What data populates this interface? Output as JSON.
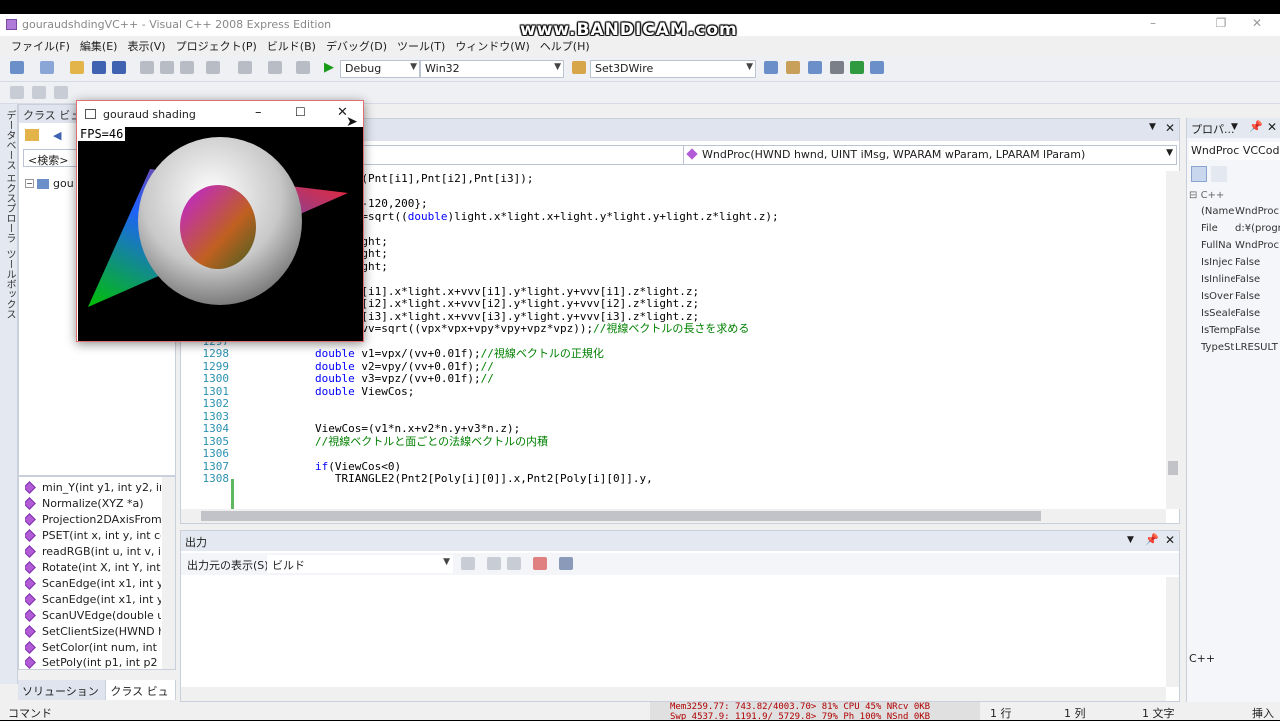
{
  "watermark": "www.BANDICAM.com",
  "window": {
    "title": "gouraudshdingVC++ - Visual C++ 2008 Express Edition"
  },
  "menu": [
    "ファイル(F)",
    "編集(E)",
    "表示(V)",
    "プロジェクト(P)",
    "ビルド(B)",
    "デバッグ(D)",
    "ツール(T)",
    "ウィンドウ(W)",
    "ヘルプ(H)"
  ],
  "toolbar": {
    "config": "Debug",
    "platform": "Win32",
    "find_text": "Set3DWire"
  },
  "side_tabs": [
    "データベース エクスプローラ",
    "ツールボックス"
  ],
  "classview": {
    "title": "クラス ビュー",
    "search_placeholder": "<検索>",
    "root": "gou"
  },
  "members": [
    "min_Y(int y1, int y2, in",
    "Normalize(XYZ *a)",
    "Projection2DAxisFrom",
    "PSET(int x, int y, int cc",
    "readRGB(int u, int v, ir",
    "Rotate(int X, int Y, int",
    "ScanEdge(int x1, int y",
    "ScanEdge(int x1, int y",
    "ScanUVEdge(double u",
    "SetClientSize(HWND h",
    "SetColor(int num, int r",
    "SetPoly(int p1, int p2"
  ],
  "left_bottom_tabs": [
    "ソリューション ...",
    "クラス ビュー"
  ],
  "editor": {
    "function_combo": "WndProc(HWND hwnd, UINT iMsg, WPARAM wParam, LPARAM lParam)",
    "lines": [
      {
        "n": "",
        "segs": [
          {
            "t": "lcCross(Pnt[i1],Pnt[i2],Pnt[i3]);",
            "c": ""
          }
        ]
      },
      {
        "n": "",
        "segs": []
      },
      {
        "n": "",
        "segs": [
          {
            "t": "t={100,-120,200};",
            "c": ""
          }
        ]
      },
      {
        "n": "",
        "segs": [
          {
            "t": "enlight=sqrt((",
            "c": ""
          },
          {
            "t": "double",
            "c": "kw"
          },
          {
            "t": ")light.x*light.x+light.y*light.y+light.z*light.z);",
            "c": ""
          }
        ]
      },
      {
        "n": "",
        "segs": []
      },
      {
        "n": "",
        "segs": [
          {
            "t": "/=lenlight;",
            "c": ""
          }
        ]
      },
      {
        "n": "",
        "segs": [
          {
            "t": "/=lenlight;",
            "c": ""
          }
        ]
      },
      {
        "n": "",
        "segs": [
          {
            "t": "/=lenlight;",
            "c": ""
          }
        ]
      },
      {
        "n": "",
        "segs": []
      },
      {
        "n": "",
        "segs": [
          {
            "t": "pe1=vvv[i1].x*light.x+vvv[i1].y*light.y+vvv[i1].z*light.z;",
            "c": ""
          }
        ]
      },
      {
        "n": "",
        "segs": [
          {
            "t": "pe2=vvv[i2].x*light.x+vvv[i2].y*light.y+vvv[i2].z*light.z;",
            "c": ""
          }
        ]
      },
      {
        "n": "",
        "segs": [
          {
            "t": "pe3=vvv[i3].x*light.x+vvv[i3].y*light.y+vvv[i3].z*light.z;",
            "c": ""
          }
        ]
      },
      {
        "n": "1296",
        "segs": [
          {
            "t": "double",
            "c": "kw"
          },
          {
            "t": " vv=sqrt((vpx*vpx+vpy*vpy+vpz*vpz));",
            "c": ""
          },
          {
            "t": "//視線ベクトルの長さを求める",
            "c": "cm"
          }
        ]
      },
      {
        "n": "1297",
        "segs": []
      },
      {
        "n": "1298",
        "segs": [
          {
            "t": "double",
            "c": "kw"
          },
          {
            "t": " v1=vpx/(vv+0.01f);",
            "c": ""
          },
          {
            "t": "//視線ベクトルの正規化",
            "c": "cm"
          }
        ]
      },
      {
        "n": "1299",
        "segs": [
          {
            "t": "double",
            "c": "kw"
          },
          {
            "t": " v2=vpy/(vv+0.01f);",
            "c": ""
          },
          {
            "t": "//",
            "c": "cm"
          }
        ]
      },
      {
        "n": "1300",
        "segs": [
          {
            "t": "double",
            "c": "kw"
          },
          {
            "t": " v3=vpz/(vv+0.01f);",
            "c": ""
          },
          {
            "t": "//",
            "c": "cm"
          }
        ]
      },
      {
        "n": "1301",
        "segs": [
          {
            "t": "double",
            "c": "kw"
          },
          {
            "t": " ViewCos;",
            "c": ""
          }
        ]
      },
      {
        "n": "1302",
        "segs": []
      },
      {
        "n": "1303",
        "segs": []
      },
      {
        "n": "1304",
        "segs": [
          {
            "t": "ViewCos=(v1*n.x+v2*n.y+v3*n.z);",
            "c": ""
          }
        ]
      },
      {
        "n": "1305",
        "segs": [
          {
            "t": "//視線ベクトルと面ごとの法線ベクトルの内積",
            "c": "cm"
          }
        ]
      },
      {
        "n": "1306",
        "segs": []
      },
      {
        "n": "1307",
        "segs": [
          {
            "t": "if",
            "c": "kw"
          },
          {
            "t": "(ViewCos<0)",
            "c": ""
          }
        ]
      },
      {
        "n": "1308",
        "segs": [
          {
            "t": "   TRIANGLE2(Pnt2[Poly[i][0]].x,Pnt2[Poly[i][0]].y,",
            "c": ""
          }
        ]
      }
    ]
  },
  "output": {
    "title": "出力",
    "source_label": "出力元の表示(S):",
    "source_value": "ビルド"
  },
  "properties": {
    "title": "プロパ...",
    "object": "WndProc VCCod",
    "category": "C++",
    "rows": [
      {
        "k": "(Name",
        "v": "WndProc"
      },
      {
        "k": "File",
        "v": "d:¥(progr"
      },
      {
        "k": "FullNa",
        "v": "WndProc"
      },
      {
        "k": "IsInjec",
        "v": "False"
      },
      {
        "k": "IsInline",
        "v": "False"
      },
      {
        "k": "IsOver",
        "v": "False"
      },
      {
        "k": "IsSeale",
        "v": "False"
      },
      {
        "k": "IsTemp",
        "v": "False"
      },
      {
        "k": "TypeSt",
        "v": "LRESULT"
      }
    ],
    "footer": "C++"
  },
  "status": {
    "left": "コマンド",
    "line": "1 行",
    "col": "1 列",
    "ch": "1 文字",
    "mode": "挿入"
  },
  "meter": {
    "line1": "Mem3259.77: 743.82/4003.70> 81% CPU 45% NRcv    0KB",
    "line2": "Swp 4537.9: 1191.9/ 5729.8> 79% Ph 100% NSnd    0KB"
  },
  "glwin": {
    "title": "gouraud shading",
    "fps": "FPS=46"
  }
}
